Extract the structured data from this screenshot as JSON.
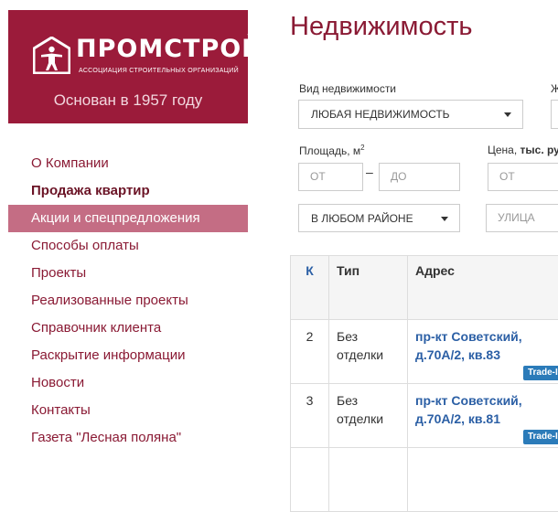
{
  "brand": {
    "name": "ПРОМСТРОЙ",
    "subtitle": "Ассоциация строительных организаций",
    "founded": "Основан в 1957 году",
    "color": "#9b1b3a"
  },
  "menu": {
    "items": [
      {
        "label": "О Компании"
      },
      {
        "label": "Продажа квартир"
      },
      {
        "label": "Акции и спецпредложения"
      },
      {
        "label": "Способы оплаты"
      },
      {
        "label": "Проекты"
      },
      {
        "label": "Реализованные проекты"
      },
      {
        "label": "Справочник клиента"
      },
      {
        "label": "Раскрытие информации"
      },
      {
        "label": "Новости"
      },
      {
        "label": "Контакты"
      },
      {
        "label": "Газета \"Лесная поляна\""
      }
    ]
  },
  "page": {
    "title": "Недвижимость"
  },
  "filters": {
    "type_label": "Вид недвижимости",
    "type_value": "Любая недвижимость",
    "area_label": "Площадь, м",
    "area_sup": "2",
    "area_from": "от",
    "area_to": "до",
    "area_dash": "–",
    "price_label": "Цена, ",
    "price_unit": "тыс. ру",
    "price_from": "от",
    "district_value": "В любом районе",
    "street_placeholder": "улица",
    "cut_label": "Ж"
  },
  "table": {
    "headers": {
      "k": "К",
      "type": "Тип",
      "address": "Адрес"
    },
    "rows": [
      {
        "k": "2",
        "type": "Без отделки",
        "address": "пр-кт Советский, д.70А/2, кв.83",
        "badge": "Trade-IN"
      },
      {
        "k": "3",
        "type": "Без отделки",
        "address": "пр-кт Советский, д.70А/2, кв.81",
        "badge": "Trade-IN"
      }
    ]
  }
}
